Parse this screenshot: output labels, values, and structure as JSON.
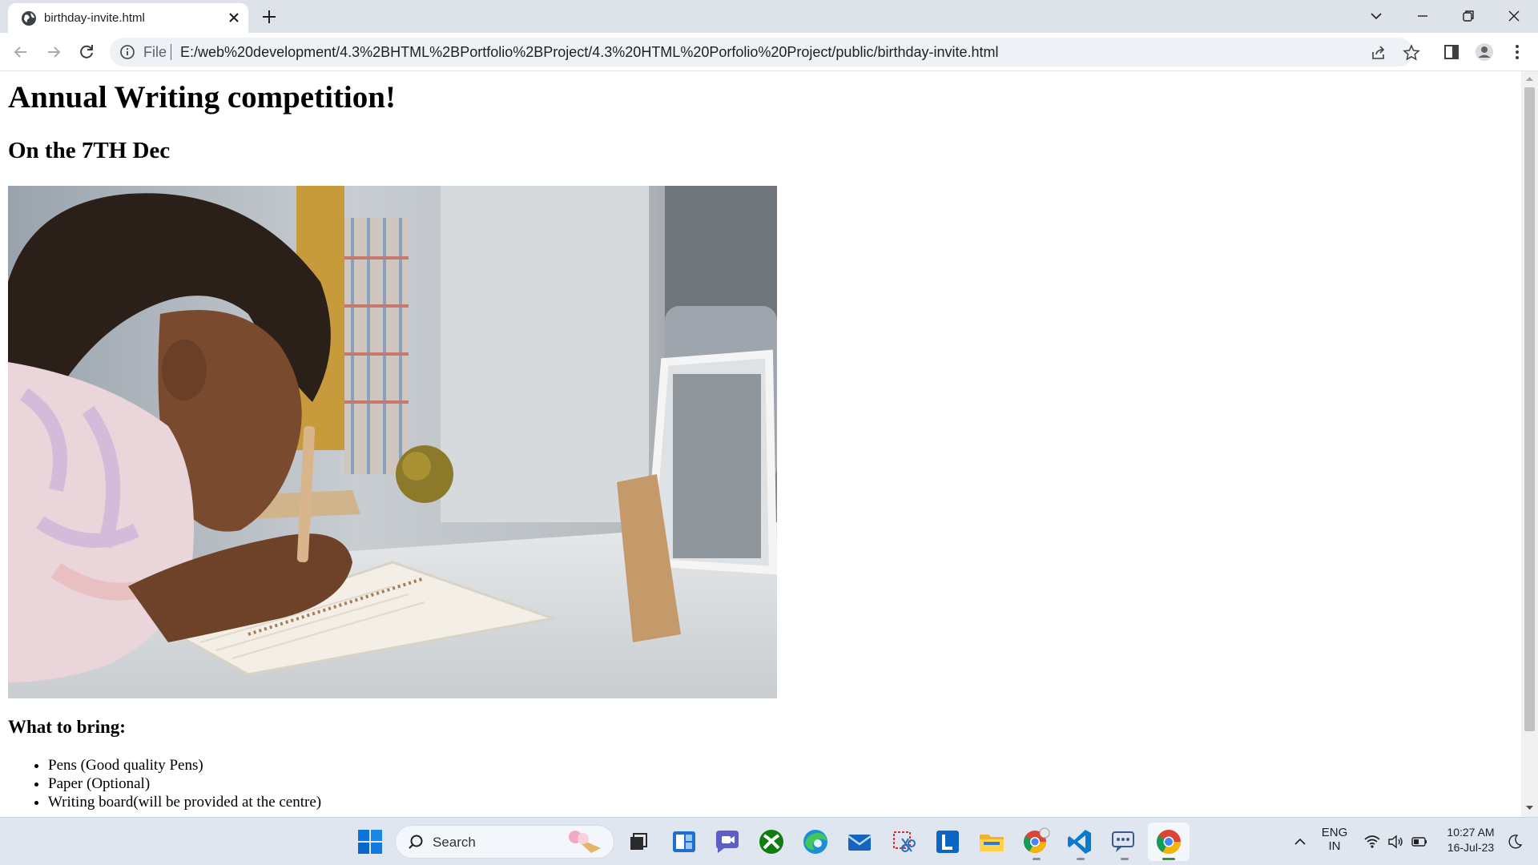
{
  "browser": {
    "tab_title": "birthday-invite.html",
    "omnibox_scheme": "File",
    "url": "E:/web%20development/4.3%2BHTML%2BPortfolio%2BProject/4.3%20HTML%20Porfolio%20Project/public/birthday-invite.html"
  },
  "page": {
    "heading": "Annual Writing competition!",
    "subheading": "On the 7TH Dec",
    "image_description": "Girl writing in a notebook at a table",
    "bring_heading": "What to bring:",
    "bring_items": [
      "Pens (Good quality Pens)",
      "Paper (Optional)",
      "Writing board(will be provided at the centre)"
    ]
  },
  "taskbar": {
    "search_label": "Search",
    "language_top": "ENG",
    "language_bottom": "IN",
    "time": "10:27 AM",
    "date": "16-Jul-23"
  },
  "colors": {
    "tabstrip": "#dee3ea",
    "omnibox": "#eef1f6",
    "taskbar": "#dfe6ef",
    "scrollbar_thumb": "#c1c1c1"
  }
}
